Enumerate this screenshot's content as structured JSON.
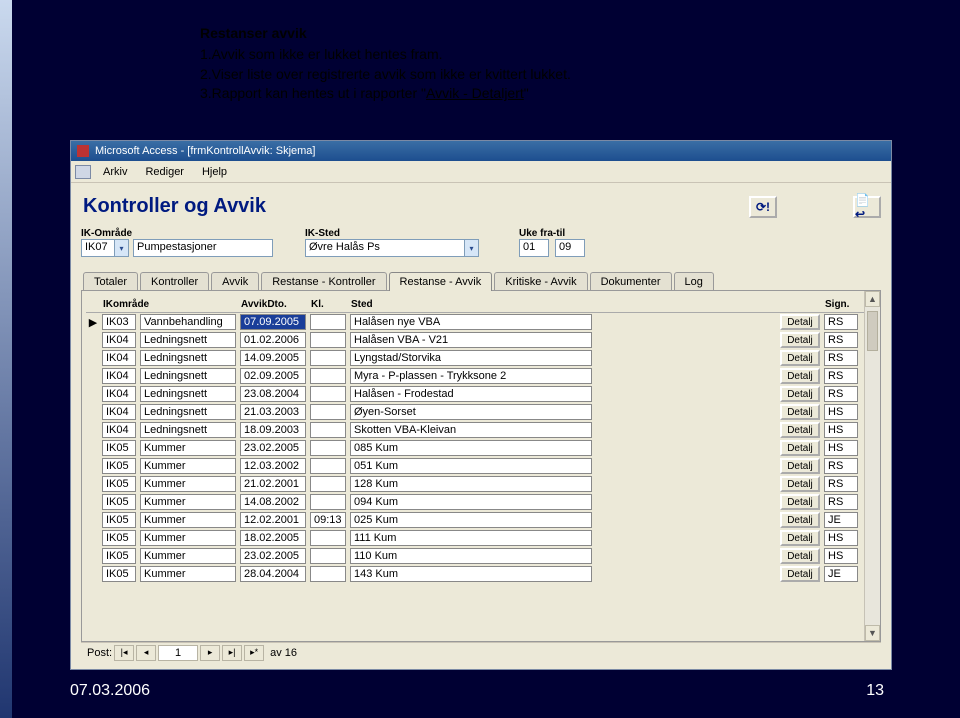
{
  "slide": {
    "heading": "Restanser avvik",
    "line1": "1.Avvik som ikke er lukket hentes fram.",
    "line2": "2.Viser liste over registrerte avvik som ikke er kvittert lukket.",
    "line3a": "3.Rapport kan hentes ut i rapporter \"",
    "line3b": "Avvik - Detaljert",
    "line3c": "\"",
    "footer_date": "07.03.2006",
    "footer_page": "13"
  },
  "app": {
    "title": "Microsoft Access - [frmKontrollAvvik: Skjema]",
    "menu": [
      "Arkiv",
      "Rediger",
      "Hjelp"
    ]
  },
  "form": {
    "title": "Kontroller og Avvik",
    "labels": {
      "ik_omrade": "IK-Område",
      "ik_sted": "IK-Sted",
      "uke": "Uke fra-til"
    },
    "ik_omrade_code": "IK07",
    "ik_omrade_name": "Pumpestasjoner",
    "ik_sted": "Øvre Halås Ps",
    "uke_fra": "01",
    "uke_til": "09",
    "tabs": [
      "Totaler",
      "Kontroller",
      "Avvik",
      "Restanse - Kontroller",
      "Restanse - Avvik",
      "Kritiske - Avvik",
      "Dokumenter",
      "Log"
    ]
  },
  "grid": {
    "headers": [
      "IKområde",
      "AvvikDto.",
      "Kl.",
      "Sted",
      "Sign."
    ],
    "detail_label": "Detalj",
    "rows": [
      {
        "sel": true,
        "code": "IK03",
        "omrade": "Vannbehandling",
        "dto": "07.09.2005",
        "kl": "",
        "sted": "Halåsen nye VBA",
        "sign": "RS",
        "dto_sel": true
      },
      {
        "code": "IK04",
        "omrade": "Ledningsnett",
        "dto": "01.02.2006",
        "kl": "",
        "sted": "Halåsen VBA - V21",
        "sign": "RS"
      },
      {
        "code": "IK04",
        "omrade": "Ledningsnett",
        "dto": "14.09.2005",
        "kl": "",
        "sted": "Lyngstad/Storvika",
        "sign": "RS"
      },
      {
        "code": "IK04",
        "omrade": "Ledningsnett",
        "dto": "02.09.2005",
        "kl": "",
        "sted": "Myra - P-plassen - Trykksone 2",
        "sign": "RS"
      },
      {
        "code": "IK04",
        "omrade": "Ledningsnett",
        "dto": "23.08.2004",
        "kl": "",
        "sted": "Halåsen - Frodestad",
        "sign": "RS"
      },
      {
        "code": "IK04",
        "omrade": "Ledningsnett",
        "dto": "21.03.2003",
        "kl": "",
        "sted": "Øyen-Sorset",
        "sign": "HS"
      },
      {
        "code": "IK04",
        "omrade": "Ledningsnett",
        "dto": "18.09.2003",
        "kl": "",
        "sted": "Skotten VBA-Kleivan",
        "sign": "HS"
      },
      {
        "code": "IK05",
        "omrade": "Kummer",
        "dto": "23.02.2005",
        "kl": "",
        "sted": "085 Kum",
        "sign": "HS"
      },
      {
        "code": "IK05",
        "omrade": "Kummer",
        "dto": "12.03.2002",
        "kl": "",
        "sted": "051 Kum",
        "sign": "RS"
      },
      {
        "code": "IK05",
        "omrade": "Kummer",
        "dto": "21.02.2001",
        "kl": "",
        "sted": "128 Kum",
        "sign": "RS"
      },
      {
        "code": "IK05",
        "omrade": "Kummer",
        "dto": "14.08.2002",
        "kl": "",
        "sted": "094 Kum",
        "sign": "RS"
      },
      {
        "code": "IK05",
        "omrade": "Kummer",
        "dto": "12.02.2001",
        "kl": "09:13",
        "sted": "025 Kum",
        "sign": "JE"
      },
      {
        "code": "IK05",
        "omrade": "Kummer",
        "dto": "18.02.2005",
        "kl": "",
        "sted": "111 Kum",
        "sign": "HS"
      },
      {
        "code": "IK05",
        "omrade": "Kummer",
        "dto": "23.02.2005",
        "kl": "",
        "sted": "110 Kum",
        "sign": "HS"
      },
      {
        "code": "IK05",
        "omrade": "Kummer",
        "dto": "28.04.2004",
        "kl": "",
        "sted": "143 Kum",
        "sign": "JE"
      }
    ]
  },
  "recordbar": {
    "label": "Post:",
    "pos": "1",
    "of_label": "av",
    "total": "16"
  }
}
